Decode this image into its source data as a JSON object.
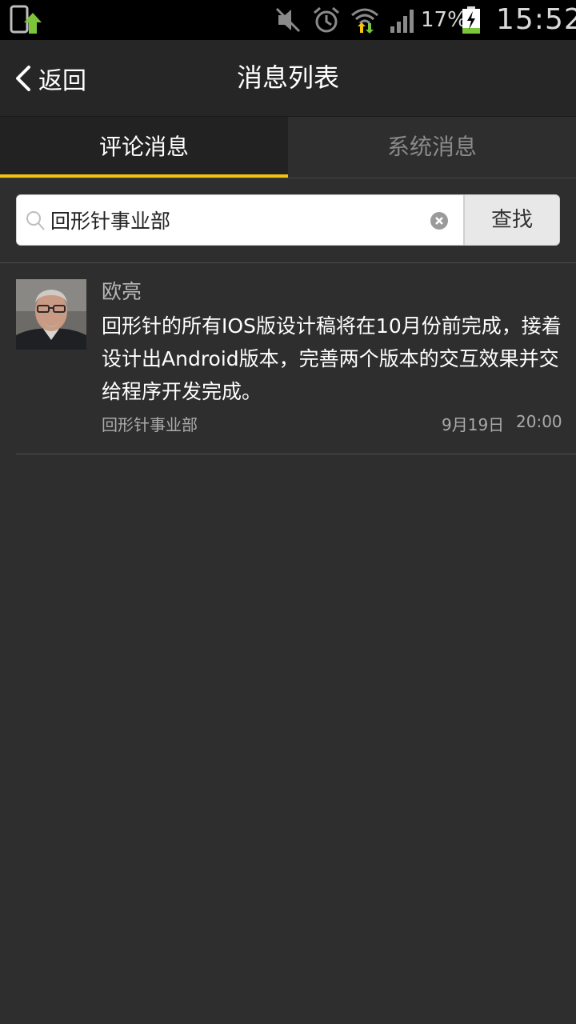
{
  "status_bar": {
    "battery_percent": "17%",
    "clock": "15:52",
    "icons": [
      "screenshot-icon",
      "mute-icon",
      "alarm-icon",
      "wifi-icon",
      "signal-icon",
      "battery-charging-icon"
    ],
    "battery_fill": 0.17
  },
  "header": {
    "back_label": "返回",
    "title": "消息列表"
  },
  "tabs": [
    {
      "label": "评论消息",
      "active": true
    },
    {
      "label": "系统消息",
      "active": false
    }
  ],
  "search": {
    "value": "回形针事业部",
    "button_label": "查找"
  },
  "messages": [
    {
      "author": "欧亮",
      "body": "回形针的所有IOS版设计稿将在10月份前完成，接着设计出Android版本，完善两个版本的交互效果并交给程序开发完成。",
      "department": "回形针事业部",
      "date": "9月19日",
      "time": "20:00"
    }
  ],
  "colors": {
    "accent": "#f2c40f",
    "background": "#2e2e2e",
    "header": "#262626",
    "status_bar": "#000000"
  }
}
